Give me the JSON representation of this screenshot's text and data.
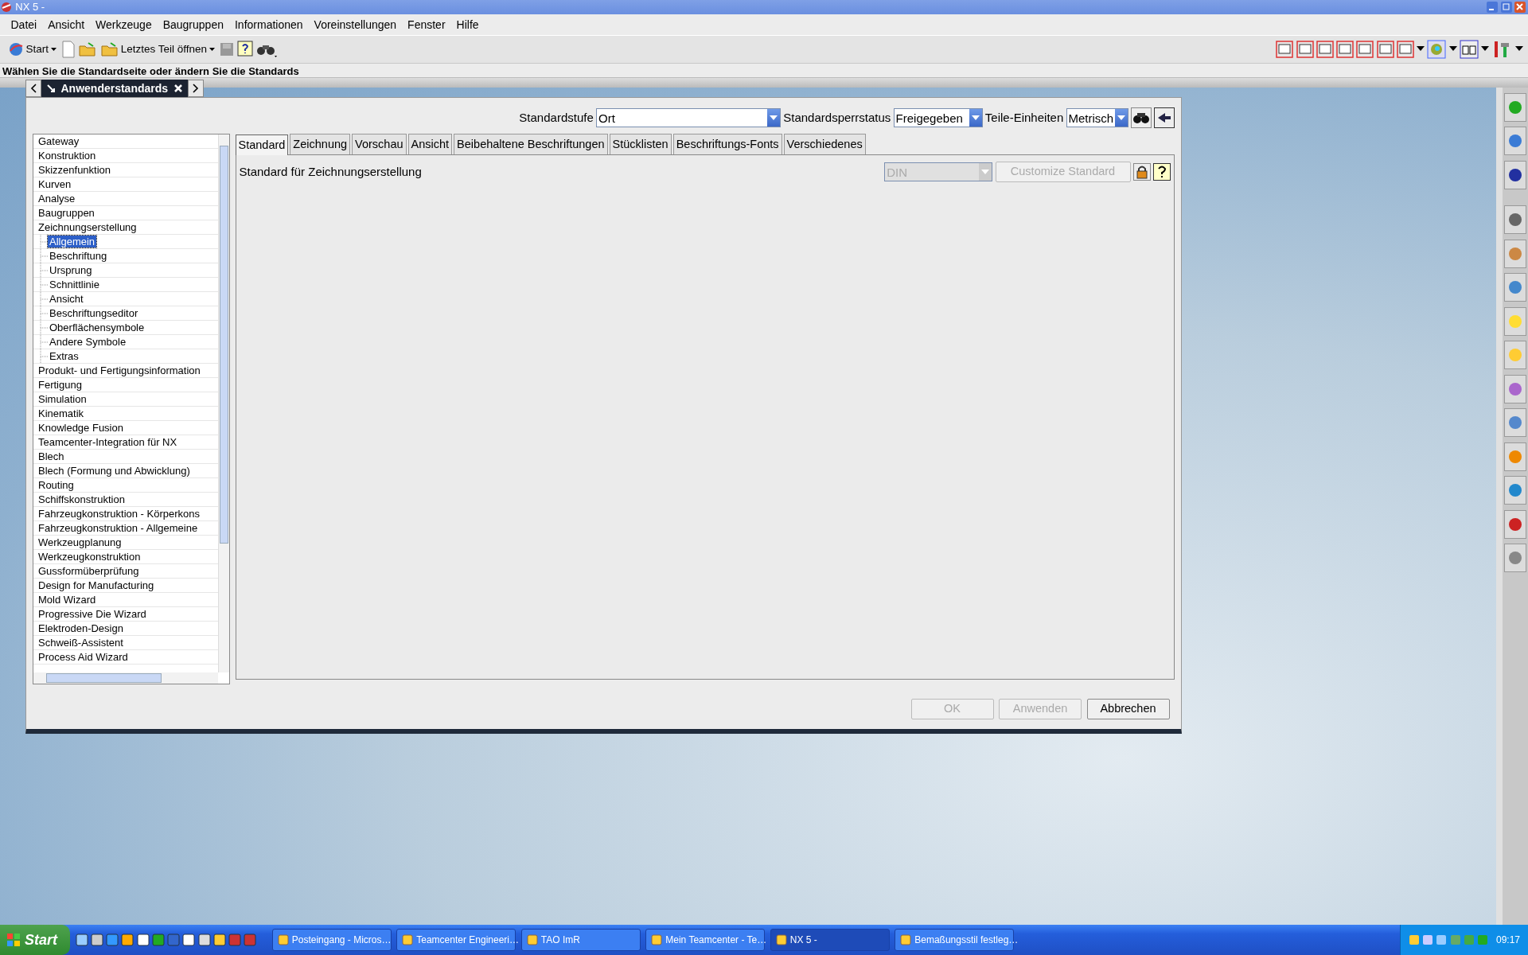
{
  "window": {
    "title": "NX 5 -"
  },
  "menu": [
    {
      "label": "Datei"
    },
    {
      "label": "Ansicht"
    },
    {
      "label": "Werkzeuge"
    },
    {
      "label": "Baugruppen"
    },
    {
      "label": "Informationen"
    },
    {
      "label": "Voreinstellungen"
    },
    {
      "label": "Fenster"
    },
    {
      "label": "Hilfe"
    }
  ],
  "toolbar": {
    "start": "Start",
    "recent": "Letztes Teil öffnen"
  },
  "cue_line": "Wählen Sie die Standardseite oder ändern Sie die Standards",
  "dialog": {
    "title": "Anwenderstandards",
    "fields": [
      {
        "label": "Standardstufe",
        "value": "Ort"
      },
      {
        "label": "Standardsperrstatus",
        "value": "Freigegeben"
      },
      {
        "label": "Teile-Einheiten",
        "value": "Metrisch"
      }
    ],
    "tree": [
      {
        "label": "Gateway",
        "selected": false
      },
      {
        "label": "Konstruktion",
        "selected": false
      },
      {
        "label": "Skizzenfunktion",
        "selected": false
      },
      {
        "label": "Kurven",
        "selected": false
      },
      {
        "label": "Analyse",
        "selected": false
      },
      {
        "label": "Baugruppen",
        "selected": false
      },
      {
        "label": "Zeichnungserstellung",
        "selected": false,
        "expanded": true,
        "children": [
          {
            "label": "Allgemein",
            "selected": true
          },
          {
            "label": "Beschriftung",
            "selected": false
          },
          {
            "label": "Ursprung",
            "selected": false
          },
          {
            "label": "Schnittlinie",
            "selected": false
          },
          {
            "label": "Ansicht",
            "selected": false
          },
          {
            "label": "Beschriftungseditor",
            "selected": false
          },
          {
            "label": "Oberflächensymbole",
            "selected": false
          },
          {
            "label": "Andere Symbole",
            "selected": false
          },
          {
            "label": "Extras",
            "selected": false
          }
        ]
      },
      {
        "label": "Produkt- und Fertigungsinformation",
        "selected": false
      },
      {
        "label": "Fertigung",
        "selected": false
      },
      {
        "label": "Simulation",
        "selected": false
      },
      {
        "label": "Kinematik",
        "selected": false
      },
      {
        "label": "Knowledge Fusion",
        "selected": false
      },
      {
        "label": "Teamcenter-Integration für NX",
        "selected": false
      },
      {
        "label": "Blech",
        "selected": false
      },
      {
        "label": "Blech (Formung und Abwicklung)",
        "selected": false
      },
      {
        "label": "Routing",
        "selected": false
      },
      {
        "label": "Schiffskonstruktion",
        "selected": false
      },
      {
        "label": "Fahrzeugkonstruktion - Körperkons",
        "selected": false
      },
      {
        "label": "Fahrzeugkonstruktion - Allgemeine",
        "selected": false
      },
      {
        "label": "Werkzeugplanung",
        "selected": false
      },
      {
        "label": "Werkzeugkonstruktion",
        "selected": false
      },
      {
        "label": "Gussformüberprüfung",
        "selected": false
      },
      {
        "label": "Design for Manufacturing",
        "selected": false
      },
      {
        "label": "Mold Wizard",
        "selected": false
      },
      {
        "label": "Progressive Die Wizard",
        "selected": false
      },
      {
        "label": "Elektroden-Design",
        "selected": false
      },
      {
        "label": "Schweiß-Assistent",
        "selected": false
      },
      {
        "label": "Process Aid Wizard",
        "selected": false
      }
    ],
    "tabs": [
      {
        "label": "Standard",
        "selected": true
      },
      {
        "label": "Zeichnung",
        "selected": false
      },
      {
        "label": "Vorschau",
        "selected": false
      },
      {
        "label": "Ansicht",
        "selected": false
      },
      {
        "label": "Beibehaltene Beschriftungen",
        "selected": false
      },
      {
        "label": "Stücklisten",
        "selected": false
      },
      {
        "label": "Beschriftungs-Fonts",
        "selected": false
      },
      {
        "label": "Verschiedenes",
        "selected": false
      }
    ],
    "content": {
      "label": "Standard für Zeichnungserstellung",
      "value": "DIN",
      "disabled": true,
      "button": "Customize Standard"
    },
    "buttons": [
      {
        "label": "OK",
        "disabled": true
      },
      {
        "label": "Anwenden",
        "disabled": true
      },
      {
        "label": "Abbrechen",
        "disabled": false
      }
    ]
  },
  "taskbar": {
    "start": "Start",
    "tasks": [
      {
        "label": "Posteingang - Micros…",
        "selected": false
      },
      {
        "label": "Teamcenter Engineeri…",
        "selected": false
      },
      {
        "label": "TAO ImR",
        "selected": false
      },
      {
        "label": "Mein Teamcenter - Te…",
        "selected": false
      },
      {
        "label": "NX 5 -",
        "selected": true
      },
      {
        "label": "Bemaßungsstil festleg…",
        "selected": false
      }
    ],
    "clock": "09:17"
  }
}
